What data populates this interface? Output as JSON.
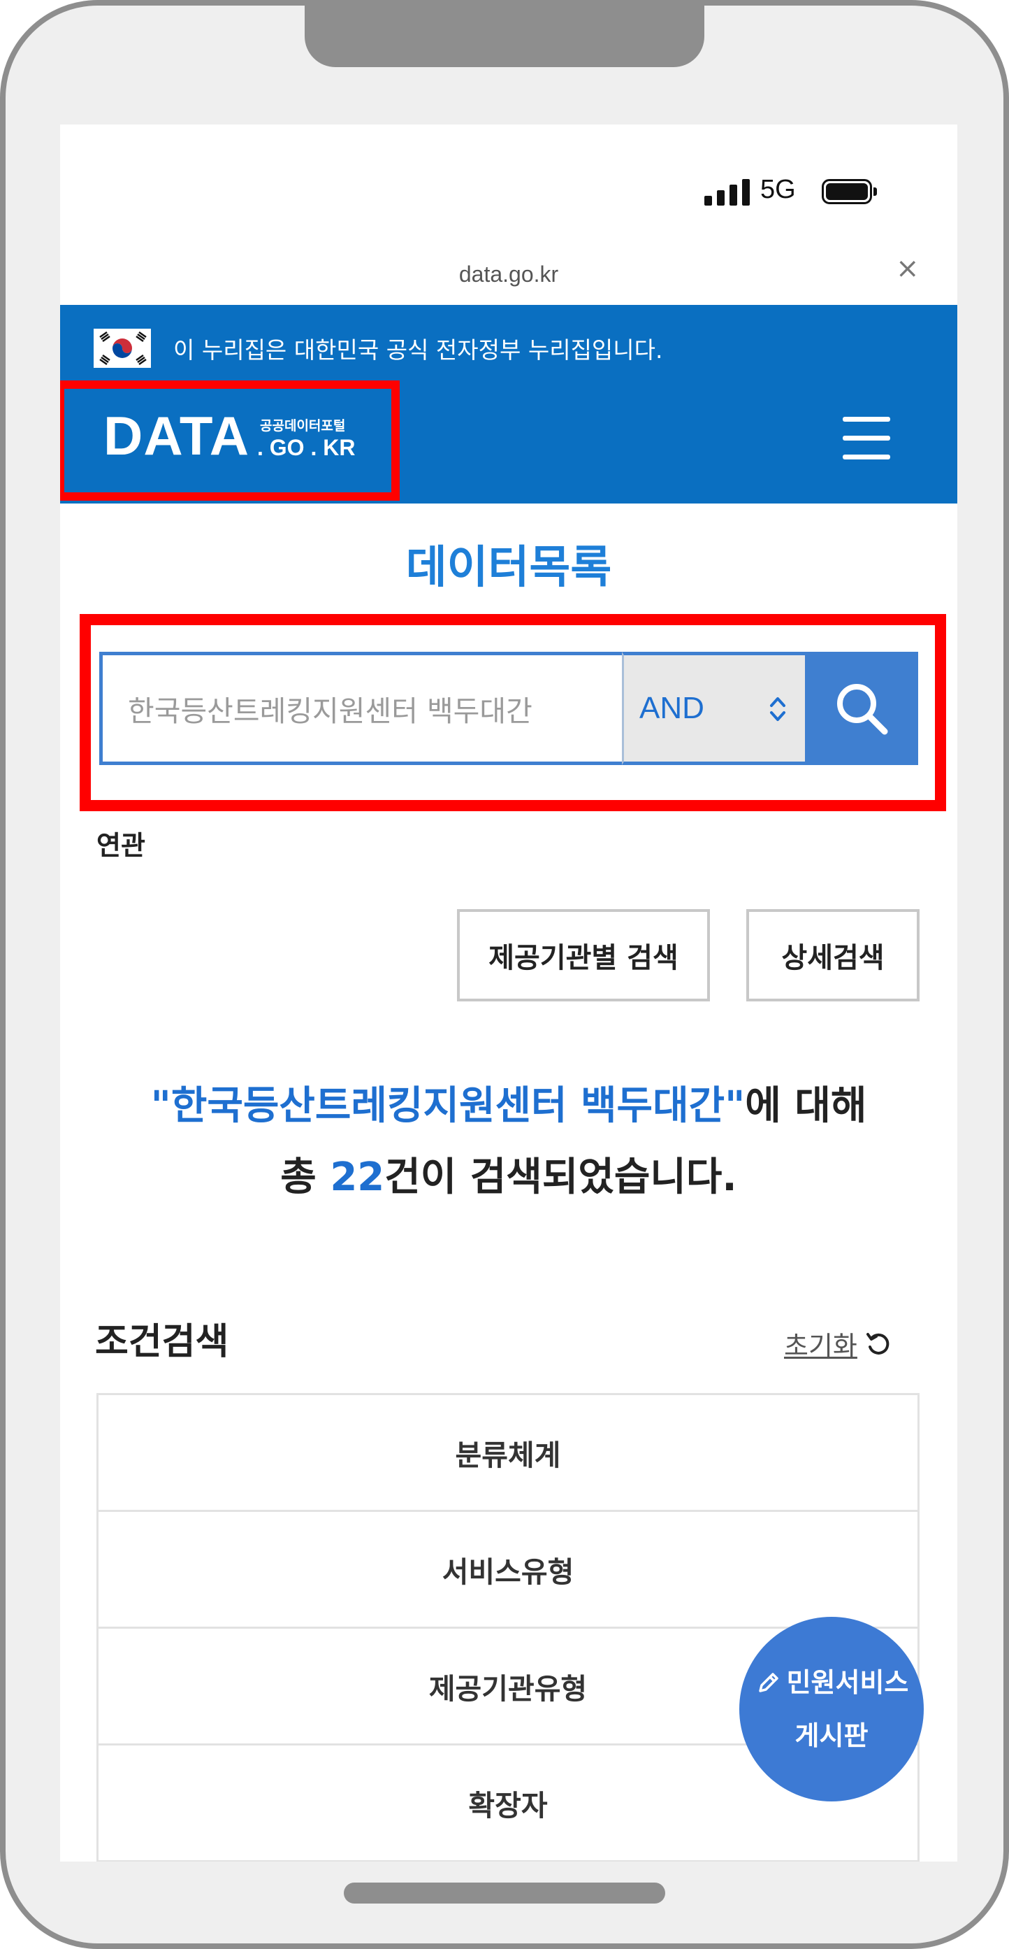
{
  "status_bar": {
    "network": "5G"
  },
  "browser": {
    "url": "data.go.kr",
    "close_glyph": "×"
  },
  "gov_banner": {
    "text": "이 누리집은 대한민국 공식 전자정부 누리집입니다."
  },
  "logo": {
    "main": "DATA",
    "sub_top": "공공데이터포털",
    "sub_bottom": ". GO . KR"
  },
  "page_title": "데이터목록",
  "search": {
    "placeholder": "한국등산트레킹지원센터 백두대간",
    "operator": "AND",
    "related_label": "연관"
  },
  "buttons": {
    "org_search": "제공기관별 검색",
    "advanced_search": "상세검색"
  },
  "result": {
    "query_quoted": "\"한국등산트레킹지원센터 백두대간\"",
    "about": "에 대해",
    "prefix": "총 ",
    "count": "22",
    "suffix": "건이 검색되었습니다."
  },
  "filters": {
    "title": "조건검색",
    "reset_label": "초기화",
    "rows": [
      {
        "label": "분류체계"
      },
      {
        "label": "서비스유형"
      },
      {
        "label": "제공기관유형"
      },
      {
        "label": "확장자"
      }
    ]
  },
  "floating": {
    "line1": "민원서비스",
    "line2": "게시판",
    "icon": "pencil-icon"
  },
  "colors": {
    "brand_blue": "#0a6fc1",
    "accent_blue": "#1e6fd0",
    "button_blue": "#3f7fd0",
    "highlight_red": "#ff0000",
    "frame_gray": "#8e8e8e"
  },
  "icons": [
    "signal-icon",
    "battery-icon",
    "close-icon",
    "flag-icon",
    "hamburger-icon",
    "chevron-updown-icon",
    "search-icon",
    "reset-icon",
    "pencil-icon"
  ]
}
